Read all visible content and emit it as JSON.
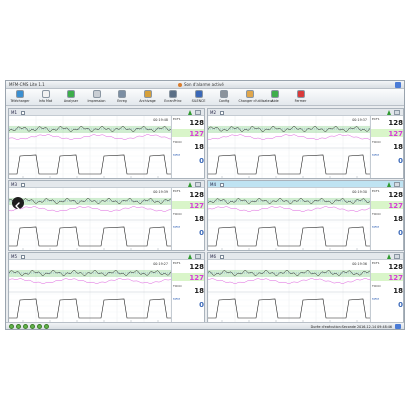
{
  "app": {
    "title": "MFM-CMS Lite 1.1",
    "sound_status": "Son d'alarme activé"
  },
  "toolbar": {
    "items": [
      {
        "label": "Télécharger",
        "icon": "download-icon",
        "color": "#3a8fd1"
      },
      {
        "label": "Info Mat",
        "icon": "patient-info-icon",
        "color": "#f2f2f2"
      },
      {
        "label": "Analyser",
        "icon": "analyze-icon",
        "color": "#3cae4a"
      },
      {
        "label": "Impression",
        "icon": "printer-icon",
        "color": "#c9ced4"
      },
      {
        "label": "Enreg",
        "icon": "save-icon",
        "color": "#7b8ea3"
      },
      {
        "label": "Archivage",
        "icon": "archive-icon",
        "color": "#d6a03a"
      },
      {
        "label": "EcranPrinc",
        "icon": "main-screen-icon",
        "color": "#5a6f86"
      },
      {
        "label": "SILENCE",
        "icon": "silence-icon",
        "color": "#3a68b8"
      },
      {
        "label": "Config",
        "icon": "settings-icon",
        "color": "#8a939c"
      },
      {
        "label": "Changer d'utilisateur",
        "icon": "switch-user-icon",
        "color": "#e0a64b"
      },
      {
        "label": "Aide",
        "icon": "help-icon",
        "color": "#3fae4c"
      },
      {
        "label": "Fermer",
        "icon": "close-icon",
        "color": "#d93a3a"
      }
    ]
  },
  "panels": [
    {
      "id": "M1",
      "time": "00:19:48",
      "fhr_label": "ECF1",
      "fhr": "128",
      "fhr2": "127",
      "toco_label": "TOCO",
      "toco": "18",
      "fm_label": "MFM",
      "fm": "0"
    },
    {
      "id": "M2",
      "time": "00:19:37",
      "fhr_label": "ECF1",
      "fhr": "128",
      "fhr2": "127",
      "toco_label": "TOCO",
      "toco": "18",
      "fm_label": "MFM",
      "fm": "0"
    },
    {
      "id": "M3",
      "time": "00:19:39",
      "fhr_label": "ECF1",
      "fhr": "128",
      "fhr2": "127",
      "toco_label": "TOCO",
      "toco": "18",
      "fm_label": "MFM",
      "fm": "0"
    },
    {
      "id": "M4",
      "time": "00:19:30",
      "fhr_label": "ECF1",
      "fhr": "128",
      "fhr2": "127",
      "toco_label": "TOCO",
      "toco": "18",
      "fm_label": "MFM",
      "fm": "0"
    },
    {
      "id": "M5",
      "time": "00:19:27",
      "fhr_label": "ECF1",
      "fhr": "128",
      "fhr2": "127",
      "toco_label": "TOCO",
      "toco": "18",
      "fm_label": "MFM",
      "fm": "0"
    },
    {
      "id": "M6",
      "time": "00:19:36",
      "fhr_label": "ECF1",
      "fhr": "128",
      "fhr2": "127",
      "toco_label": "TOCO",
      "toco": "18",
      "fm_label": "MFM",
      "fm": "0"
    }
  ],
  "status": {
    "duration": "Durée d'exécution:Seconde 2016-12-14 09:48:46"
  },
  "colors": {
    "fhr": "#2a2a2a",
    "fhr2": "#d63bd6",
    "toco": "#1f1f1f",
    "baseline_band": "#2fb32f",
    "active_header": "#bfe3f2"
  }
}
